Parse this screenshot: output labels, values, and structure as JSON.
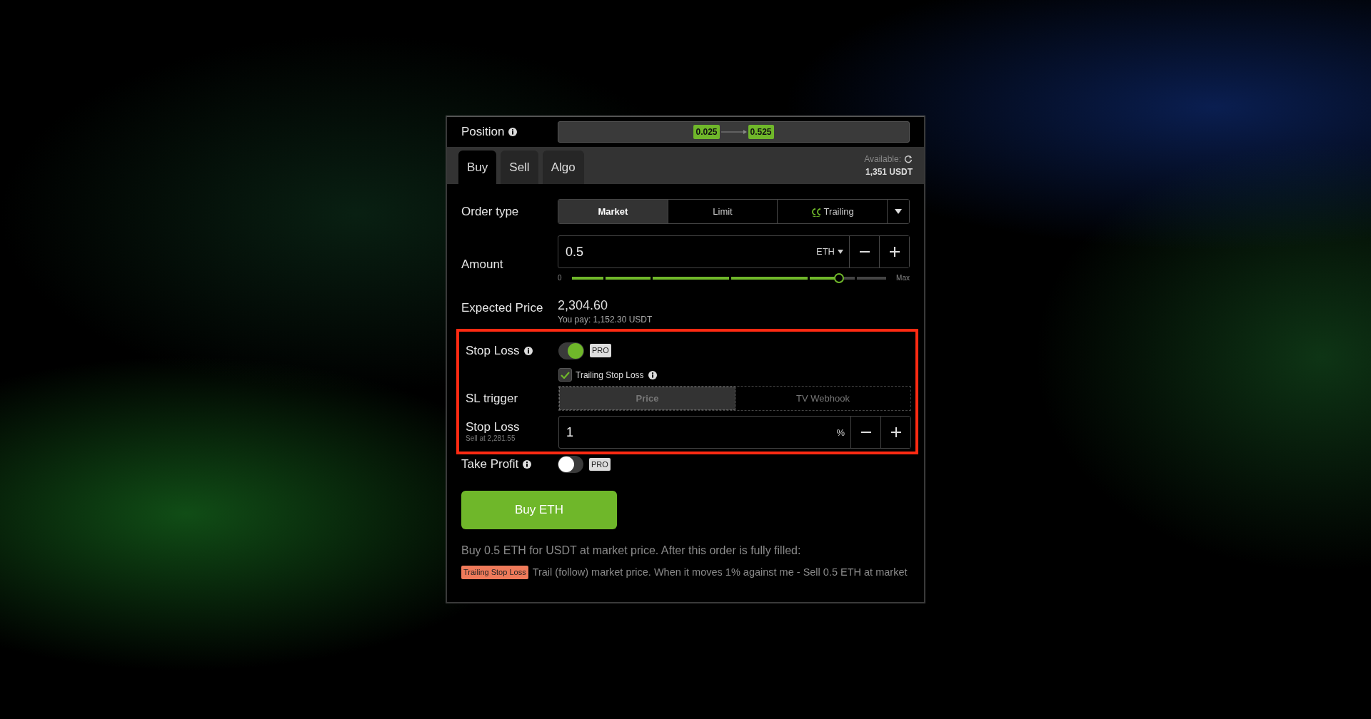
{
  "position": {
    "label": "Position",
    "from": "0.025",
    "to": "0.525"
  },
  "tabs": [
    {
      "label": "Buy",
      "selected": true
    },
    {
      "label": "Sell",
      "selected": false
    },
    {
      "label": "Algo",
      "selected": false
    }
  ],
  "available": {
    "label": "Available:",
    "value": "1,351 USDT"
  },
  "order_type": {
    "label": "Order type",
    "options": [
      {
        "label": "Market",
        "selected": true,
        "kind": "plain"
      },
      {
        "label": "Limit",
        "selected": false,
        "kind": "plain"
      },
      {
        "label": "Trailing",
        "selected": false,
        "kind": "logo"
      }
    ]
  },
  "amount": {
    "label": "Amount",
    "value": "0.5",
    "unit": "ETH",
    "slider_min": "0",
    "slider_max": "Max",
    "level": 0.85
  },
  "expected_price": {
    "label": "Expected Price",
    "value": "2,304.60",
    "note": "You pay: 1,152.30 USDT"
  },
  "stop_loss": {
    "label": "Stop Loss",
    "on": true,
    "badge": "PRO",
    "trailing": {
      "label": "Trailing Stop Loss",
      "checked": true
    },
    "trigger": {
      "label": "SL trigger",
      "options": [
        {
          "label": "Price",
          "selected": true
        },
        {
          "label": "TV Webhook",
          "selected": false
        }
      ]
    },
    "value_label": "Stop Loss",
    "value_note": "Sell at 2,281.55",
    "value": "1",
    "unit": "%"
  },
  "take_profit": {
    "label": "Take Profit",
    "on": false,
    "badge": "PRO"
  },
  "submit": "Buy ETH",
  "summary": "Buy 0.5 ETH for USDT at market price. After this order is fully filled:",
  "details": {
    "badge": "Trailing Stop Loss",
    "text": "Trail (follow) market price. When it moves 1% against me - Sell 0.5 ETH at market"
  }
}
